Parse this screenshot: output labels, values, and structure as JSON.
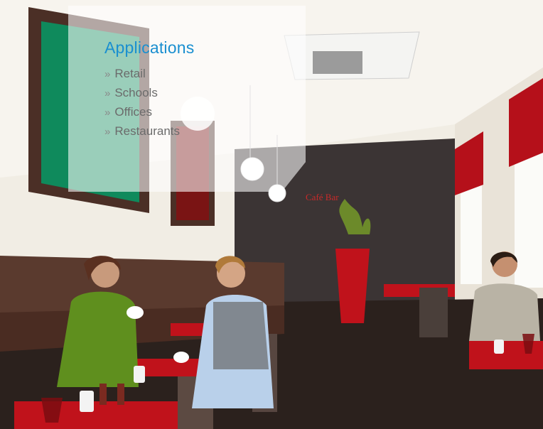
{
  "panel": {
    "title": "Applications",
    "bullet": "»",
    "items": [
      "Retail",
      "Schools",
      "Offices",
      "Restaurants"
    ]
  },
  "scene": {
    "signage": "Café Bar",
    "colors": {
      "wall": "#f3efe6",
      "dark_wall": "#3b3434",
      "floor": "#2b211d",
      "banquette": "#5a3a2e",
      "tablecloth": "#c0121b",
      "accent_blue": "#1a8fd0"
    }
  }
}
